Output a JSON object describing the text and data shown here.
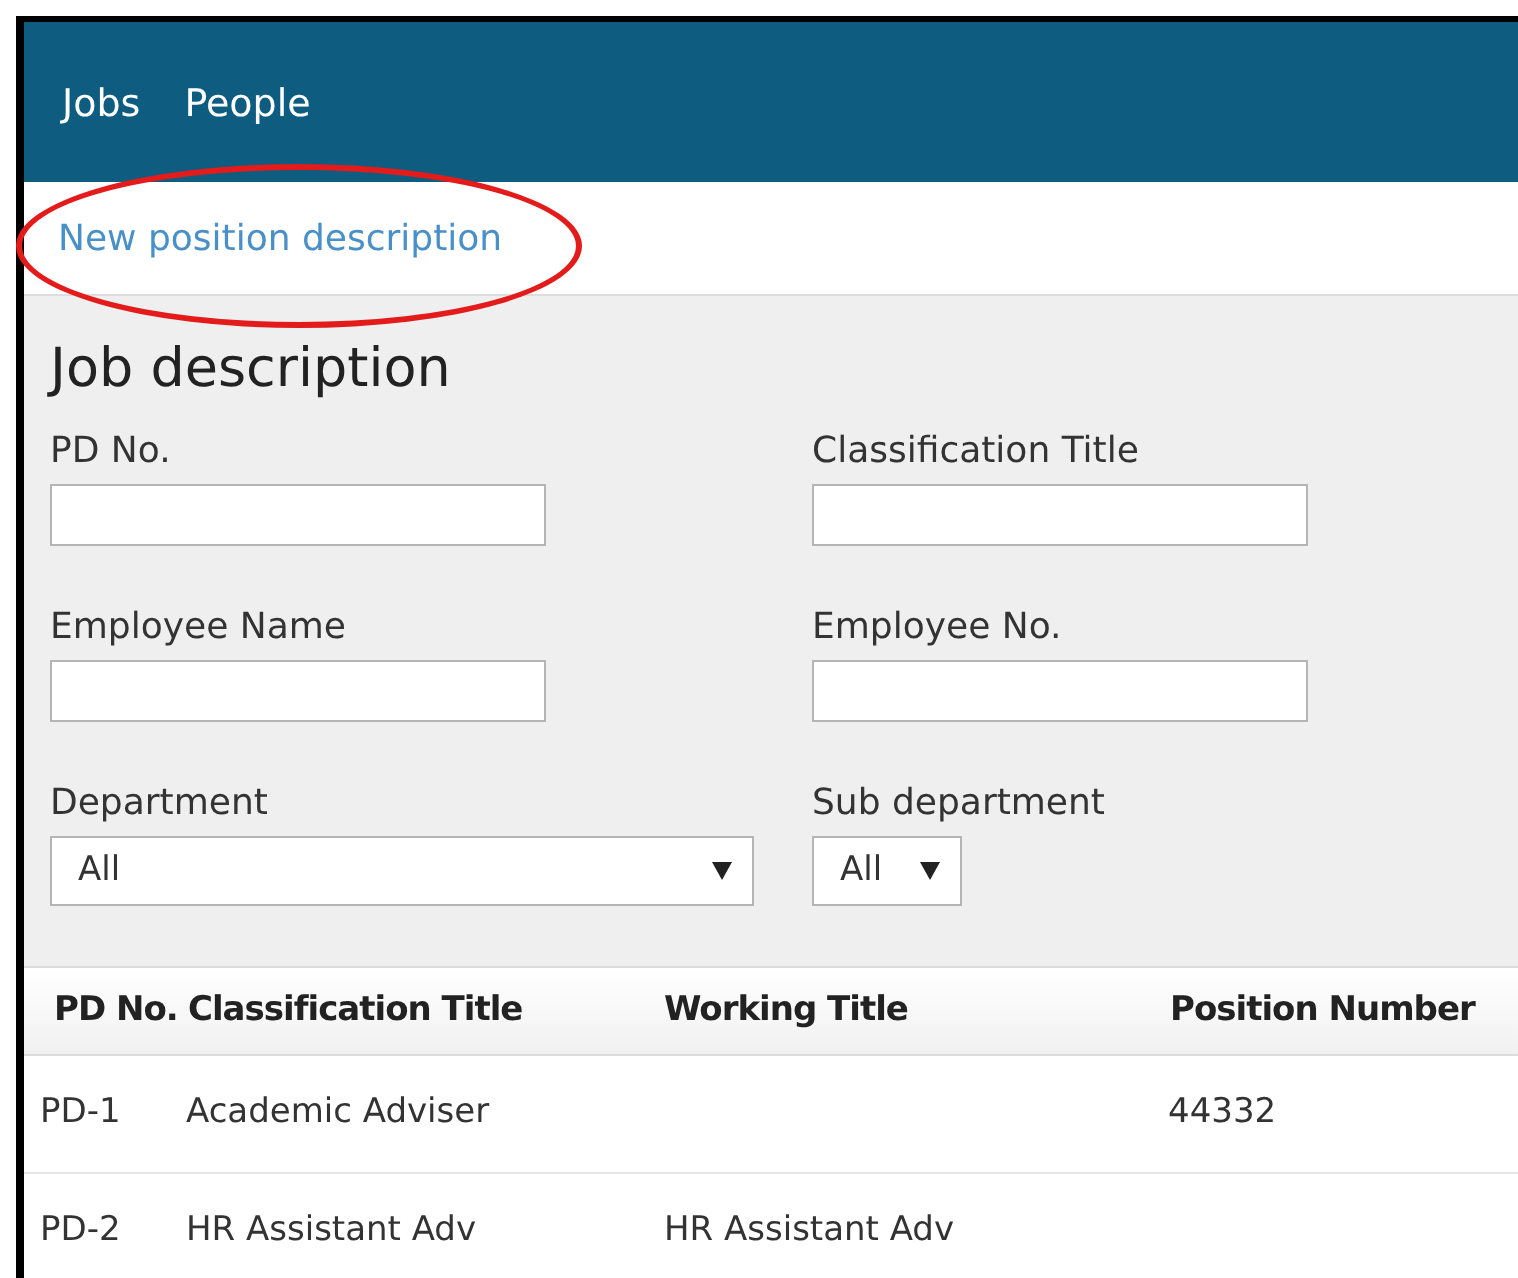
{
  "nav": {
    "items": [
      "Jobs",
      "People"
    ]
  },
  "action_link": "New position description",
  "annotation": {
    "kind": "ellipse"
  },
  "form": {
    "title": "Job description",
    "fields": [
      {
        "kind": "text",
        "label": "PD No."
      },
      {
        "kind": "text",
        "label": "Classification Title"
      },
      {
        "kind": "text",
        "label": "Employee Name"
      },
      {
        "kind": "text",
        "label": "Employee No."
      },
      {
        "kind": "select",
        "label": "Department",
        "value": "All"
      },
      {
        "kind": "select",
        "label": "Sub department",
        "value": "All"
      }
    ]
  },
  "table": {
    "columns": [
      "PD No.",
      "Classification Title",
      "Working Title",
      "Position Number"
    ],
    "rows": [
      [
        "PD-1",
        "Academic Adviser",
        "",
        "44332"
      ],
      [
        "PD-2",
        "HR Assistant Adv",
        "HR Assistant Adv",
        ""
      ]
    ]
  }
}
